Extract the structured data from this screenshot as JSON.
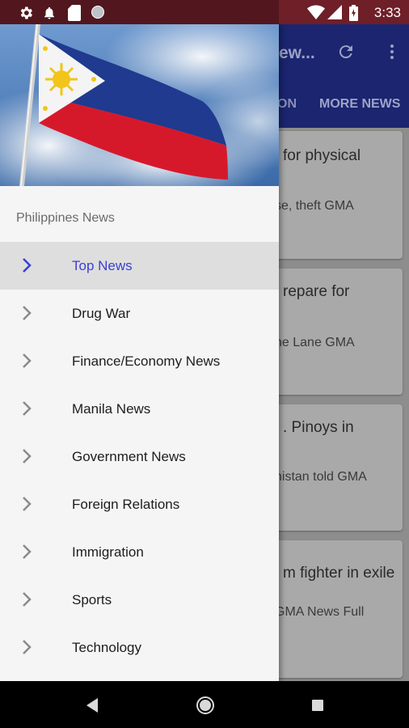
{
  "status_bar": {
    "time": "3:33",
    "icons_left": [
      "settings-icon",
      "notification-bell-icon",
      "sd-card-icon",
      "circle-icon"
    ],
    "icons_right": [
      "wifi-icon",
      "signal-icon",
      "battery-icon"
    ]
  },
  "app": {
    "toolbar_title_partial": "ew...",
    "tabs": {
      "partial": "ON",
      "more": "MORE NEWS"
    },
    "cards": [
      {
        "title": "for physical",
        "source": "se, theft  GMA"
      },
      {
        "title": "repare for",
        "source": "ne Lane  GMA"
      },
      {
        "title": ". Pinoys in",
        "source": "nistan told  GMA"
      },
      {
        "title": "m fighter in exile",
        "source": "GMA News  Full"
      }
    ]
  },
  "drawer": {
    "section_title": "Philippines News",
    "items": [
      {
        "label": "Top News",
        "selected": true
      },
      {
        "label": "Drug War"
      },
      {
        "label": "Finance/Economy News"
      },
      {
        "label": "Manila News"
      },
      {
        "label": "Government News"
      },
      {
        "label": "Foreign Relations"
      },
      {
        "label": "Immigration"
      },
      {
        "label": "Sports"
      },
      {
        "label": "Technology"
      }
    ]
  },
  "colors": {
    "accent": "#3a3fd2",
    "toolbar": "#1b2570",
    "status_bar": "#6e1f28"
  }
}
